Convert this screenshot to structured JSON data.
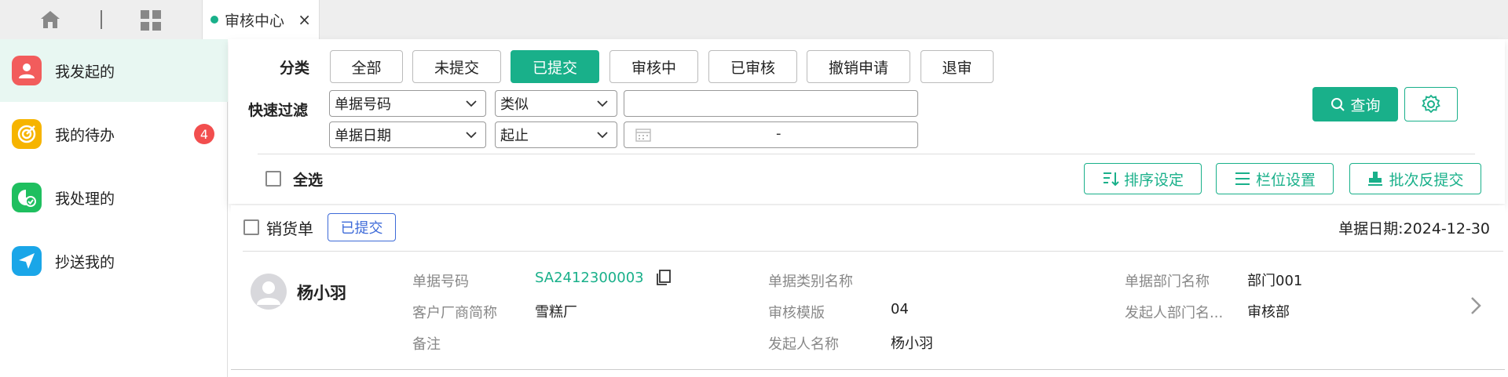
{
  "tab": {
    "title": "审核中心",
    "close": "×"
  },
  "sidebar": {
    "items": [
      {
        "label": "我发起的",
        "icon": "user-icon",
        "color": "#f25c5c",
        "active": true
      },
      {
        "label": "我的待办",
        "icon": "target-icon",
        "color": "#f6b400",
        "badge": "4"
      },
      {
        "label": "我处理的",
        "icon": "check-pie-icon",
        "color": "#1fbf5f"
      },
      {
        "label": "抄送我的",
        "icon": "send-icon",
        "color": "#1aa6e8"
      }
    ]
  },
  "filter": {
    "category_label": "分类",
    "categories": [
      "全部",
      "未提交",
      "已提交",
      "审核中",
      "已审核",
      "撤销申请",
      "退审"
    ],
    "active_category": "已提交",
    "quick_label": "快速过滤",
    "row1": {
      "field": "单据号码",
      "op": "类似",
      "value": ""
    },
    "row2": {
      "field": "单据日期",
      "op": "起止",
      "range_sep": "-"
    },
    "query_label": "查询",
    "select_all": "全选",
    "sort_label": "排序设定",
    "column_label": "栏位设置",
    "batch_label": "批次反提交"
  },
  "colors": {
    "accent": "#19b08a",
    "status_blue": "#3d6ad8",
    "badge_red": "#f24e4e"
  },
  "card": {
    "doc_type": "销货单",
    "status": "已提交",
    "date": "单据日期:2024-12-30",
    "user": "杨小羽",
    "fields": {
      "doc_no_label": "单据号码",
      "doc_no": "SA2412300003",
      "customer_label": "客户厂商简称",
      "customer": "雪糕厂",
      "remark_label": "备注",
      "category_label": "单据类别名称",
      "template_label": "审核模版",
      "template": "04",
      "initiator_label": "发起人名称",
      "initiator": "杨小羽",
      "dept_label": "单据部门名称",
      "dept": "部门001",
      "init_dept_label": "发起人部门名...",
      "init_dept": "审核部"
    }
  }
}
